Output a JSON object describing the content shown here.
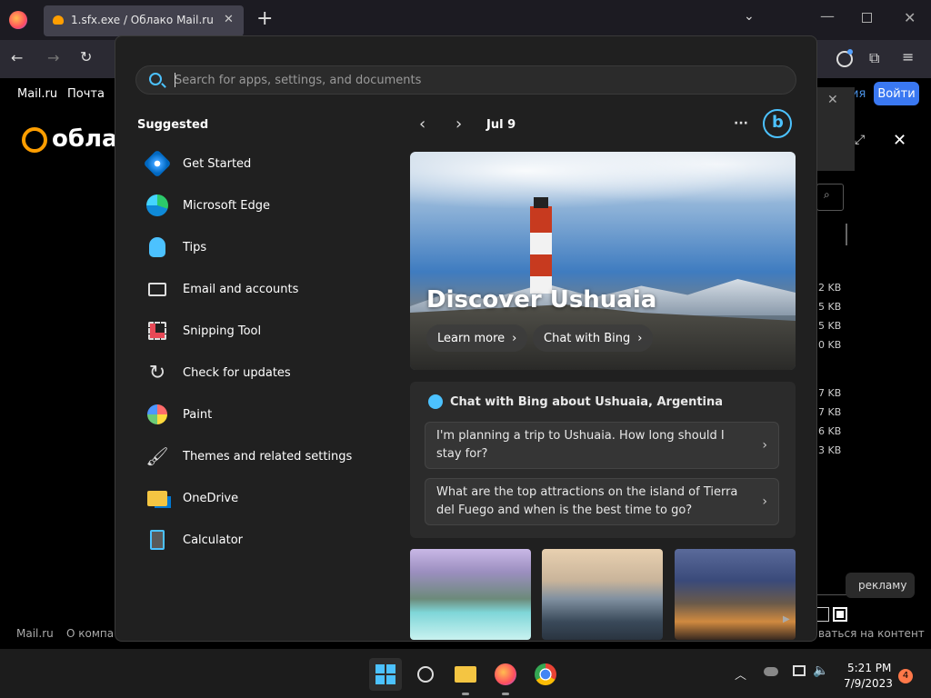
{
  "browser": {
    "tab_title": "1.sfx.exe / Облако Mail.ru",
    "new_tab": "+",
    "tab_close": "✕"
  },
  "bgpage": {
    "nav_mailru": "Mail.ru",
    "nav_pochta": "Почта",
    "logo_text": "облак",
    "login_button": "Войти",
    "partial_link": "ия",
    "sizes": [
      "2 KB",
      "5 KB",
      "5 KB",
      "0 KB",
      "7 KB",
      "7 KB",
      "6 KB",
      "3 KB"
    ],
    "ad_button": "рекламу",
    "footer_mailru": "Mail.ru",
    "footer_about": "О компа",
    "footer_right": "ваться на контент"
  },
  "start": {
    "search_placeholder": "Search for apps, settings, and documents",
    "suggested_heading": "Suggested",
    "apps": [
      {
        "label": "Get Started"
      },
      {
        "label": "Microsoft Edge"
      },
      {
        "label": "Tips"
      },
      {
        "label": "Email and accounts"
      },
      {
        "label": "Snipping Tool"
      },
      {
        "label": "Check for updates"
      },
      {
        "label": "Paint"
      },
      {
        "label": "Themes and related settings"
      },
      {
        "label": "OneDrive"
      },
      {
        "label": "Calculator"
      }
    ],
    "date": "Jul 9",
    "more": "···",
    "hero_title": "Discover Ushuaia",
    "learn_more": "Learn more",
    "chat_bing": "Chat with Bing",
    "chat_card_title": "Chat with Bing about Ushuaia, Argentina",
    "questions": [
      "I'm planning a trip to Ushuaia. How long should I stay for?",
      "What are the top attractions on the island of Tierra del Fuego and when is the best time to go?"
    ]
  },
  "taskbar": {
    "time": "5:21 PM",
    "date": "7/9/2023",
    "notification_count": "4"
  },
  "colors": {
    "accent": "#4cc2ff",
    "login_blue": "#3a78f2",
    "mailru_orange": "#ff9e00"
  }
}
